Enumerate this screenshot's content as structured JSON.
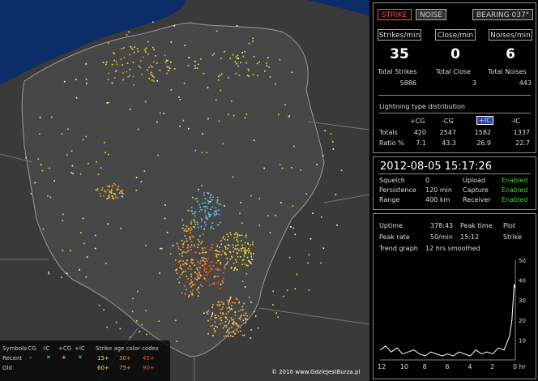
{
  "tabs": {
    "strike": "STRIKE",
    "noise": "NOISE",
    "bearing": "BEARING 037°"
  },
  "counters": [
    {
      "label": "Strikes/min",
      "value": "35"
    },
    {
      "label": "Close/min",
      "value": "0"
    },
    {
      "label": "Noises/min",
      "value": "6"
    }
  ],
  "totals": [
    {
      "label": "Total Strikes",
      "value": "5886"
    },
    {
      "label": "Total Close",
      "value": "3"
    },
    {
      "label": "Total Noises",
      "value": "443"
    }
  ],
  "distribution": {
    "title": "Lightning type distribution",
    "headers": [
      "+CG",
      "-CG",
      "+IC",
      "-IC"
    ],
    "rows": [
      {
        "label": "Totals",
        "values": [
          "420",
          "2547",
          "1582",
          "1337"
        ]
      },
      {
        "label": "Ratio %",
        "values": [
          "7.1",
          "43.3",
          "26.9",
          "22.7"
        ]
      }
    ]
  },
  "datetime": "2012-08-05 15:17:26",
  "status": [
    {
      "label": "Squelch",
      "value": "0",
      "label2": "Upload",
      "value2": "Enabled"
    },
    {
      "label": "Persistence",
      "value": "120 min",
      "label2": "Capture",
      "value2": "Enabled"
    },
    {
      "label": "Range",
      "value": "400 km",
      "label2": "Receiver",
      "value2": "Enabled"
    }
  ],
  "trend": {
    "uptime_label": "Uptime",
    "uptime": "378:43",
    "peaktime_label": "Peak time",
    "peaktime": "15:12",
    "plot_label": "Plot",
    "plot": "Strike",
    "peakrate_label": "Peak rate",
    "peakrate": "50/min",
    "graph_label": "Trend graph",
    "graph_value": "12 hrs smoothed"
  },
  "chart_data": {
    "type": "line",
    "x_ticks": [
      "12",
      "10",
      "8",
      "6",
      "4",
      "2",
      "0 hr"
    ],
    "y_ticks": [
      "50",
      "40",
      "30",
      "20",
      "10"
    ],
    "ylim": [
      0,
      50
    ],
    "xlim": [
      12,
      0
    ],
    "x": [
      12,
      11.5,
      11,
      10.5,
      10,
      9.5,
      9,
      8.5,
      8,
      7.5,
      7,
      6.5,
      6,
      5.5,
      5,
      4.5,
      4,
      3.5,
      3,
      2.5,
      2,
      1.5,
      1,
      0.5,
      0.3,
      0.1,
      0
    ],
    "values": [
      5,
      7,
      4,
      6,
      3,
      4,
      5,
      3,
      2,
      4,
      3,
      2,
      3,
      2,
      4,
      3,
      2,
      5,
      3,
      4,
      3,
      6,
      5,
      12,
      20,
      38,
      36
    ]
  },
  "legend": {
    "symbols_label": "Symbols",
    "types": [
      "-CG",
      "-IC",
      "+CG",
      "+IC"
    ],
    "recent_label": "Recent",
    "old_label": "Old",
    "age_label": "Strike age color codes",
    "recent_codes": [
      "15+",
      "30+",
      "45+"
    ],
    "old_codes": [
      "60+",
      "75+",
      "90+"
    ]
  },
  "copyright": "© 2010 www.GdzieJestBurza.pl",
  "colors": {
    "strike_tab_text": "#ff5050",
    "enabled": "#30e030",
    "ic_badge": "#2a3fc0",
    "sea": "#0b2d6a",
    "land": "#3a3a3a"
  }
}
